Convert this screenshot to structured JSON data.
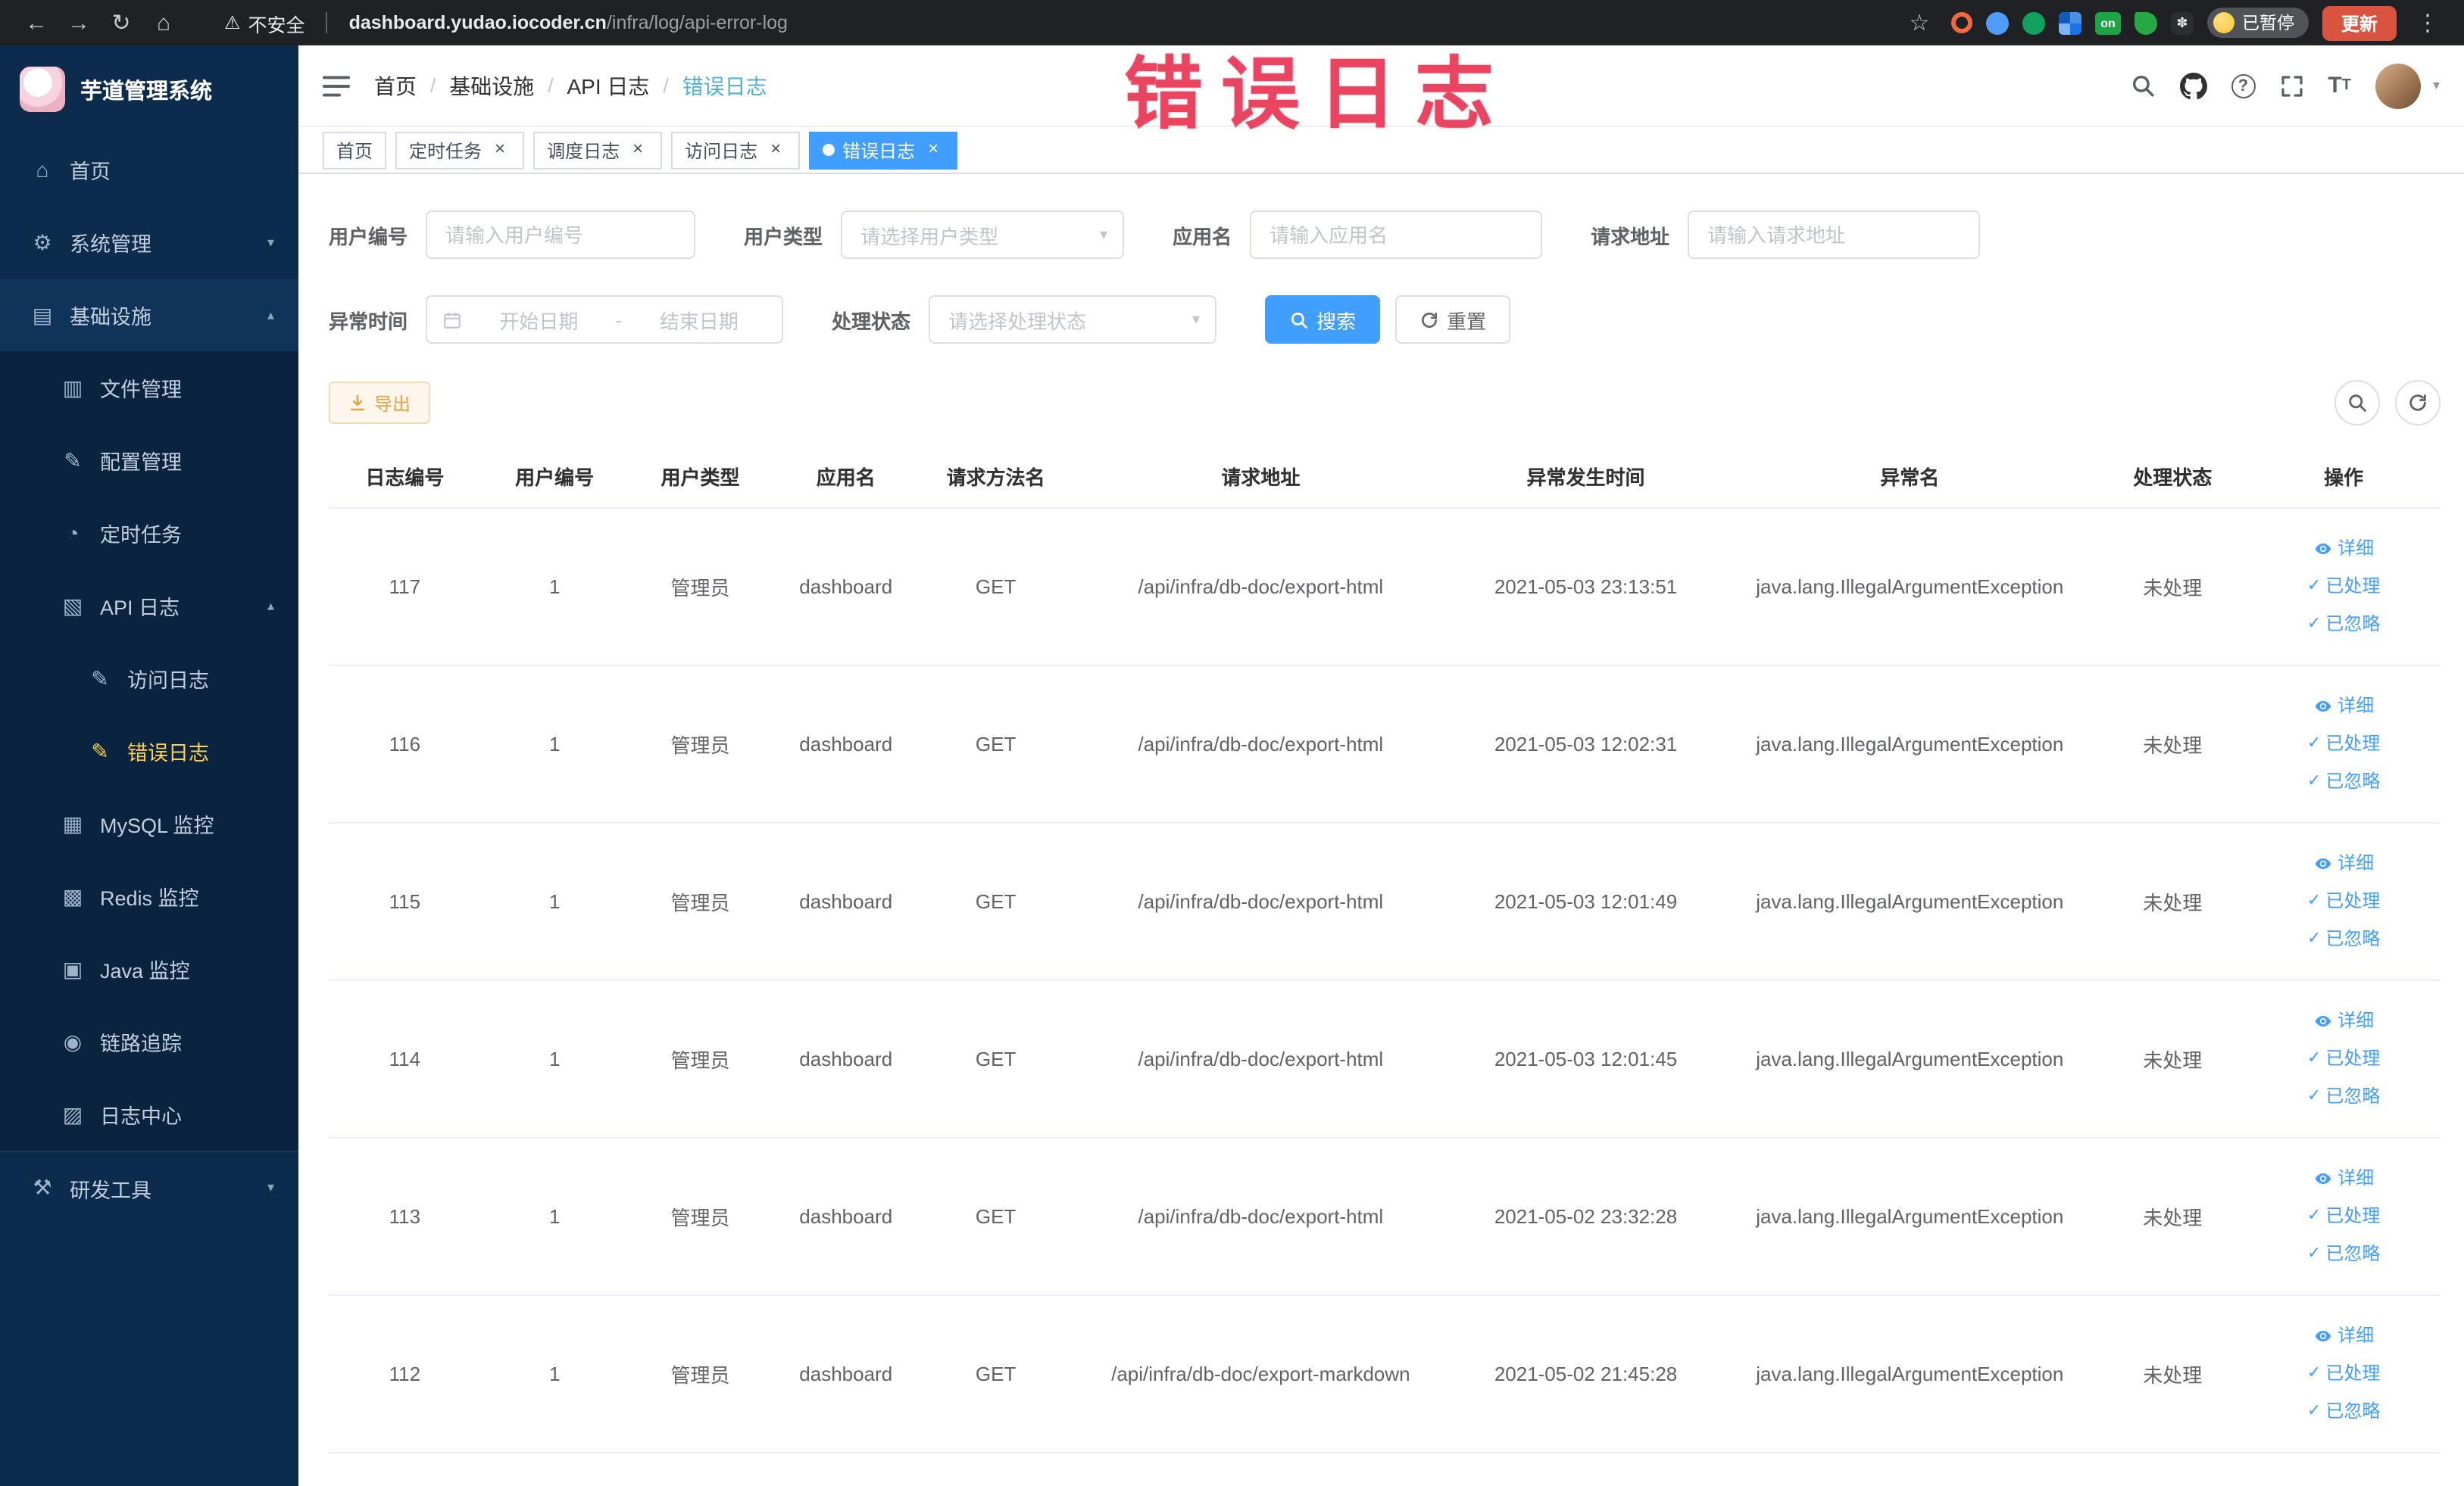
{
  "browser": {
    "warning_text": "不安全",
    "url_domain": "dashboard.yudao.iocoder.cn",
    "url_path": "/infra/log/api-error-log",
    "extension_on_label": "on",
    "paused_badge": "已暂停",
    "update_button": "更新"
  },
  "annotation": {
    "text": "错误日志"
  },
  "sidebar": {
    "logo_title": "芋道管理系统",
    "items": [
      {
        "key": "home",
        "label": "首页",
        "icon": "home-icon",
        "level": 1
      },
      {
        "key": "system-mgmt",
        "label": "系统管理",
        "icon": "gear-icon",
        "level": 1,
        "arrow": "down"
      },
      {
        "key": "infrastructure",
        "label": "基础设施",
        "icon": "infra-icon",
        "level": 1,
        "arrow": "up",
        "highlight": true
      },
      {
        "key": "file-mgmt",
        "label": "文件管理",
        "icon": "file-icon",
        "level": 2
      },
      {
        "key": "config-mgmt",
        "label": "配置管理",
        "icon": "config-icon",
        "level": 2
      },
      {
        "key": "cron-job",
        "label": "定时任务",
        "icon": "timer-icon",
        "level": 2
      },
      {
        "key": "api-log",
        "label": "API 日志",
        "icon": "api-log-icon",
        "level": 2,
        "arrow": "up"
      },
      {
        "key": "access-log",
        "label": "访问日志",
        "icon": "access-log-icon",
        "level": 3
      },
      {
        "key": "error-log",
        "label": "错误日志",
        "icon": "error-log-icon",
        "level": 3,
        "active": true
      },
      {
        "key": "mysql-monitor",
        "label": "MySQL 监控",
        "icon": "mysql-icon",
        "level": 2
      },
      {
        "key": "redis-monitor",
        "label": "Redis 监控",
        "icon": "redis-icon",
        "level": 2
      },
      {
        "key": "java-monitor",
        "label": "Java 监控",
        "icon": "java-icon",
        "level": 2
      },
      {
        "key": "tracing",
        "label": "链路追踪",
        "icon": "trace-icon",
        "level": 2
      },
      {
        "key": "log-center",
        "label": "日志中心",
        "icon": "log-center-icon",
        "level": 2
      },
      {
        "key": "dev-tools",
        "label": "研发工具",
        "icon": "tools-icon",
        "level": 1,
        "arrow": "down",
        "section": true
      }
    ]
  },
  "header": {
    "breadcrumbs": [
      {
        "key": "home",
        "label": "首页"
      },
      {
        "key": "infrastructure",
        "label": "基础设施"
      },
      {
        "key": "api-log",
        "label": "API 日志"
      },
      {
        "key": "error-log",
        "label": "错误日志",
        "current": true
      }
    ]
  },
  "tabs": [
    {
      "key": "home",
      "label": "首页",
      "closable": false,
      "active": false
    },
    {
      "key": "cron-job",
      "label": "定时任务",
      "closable": true,
      "active": false
    },
    {
      "key": "schedule-log",
      "label": "调度日志",
      "closable": true,
      "active": false
    },
    {
      "key": "access-log",
      "label": "访问日志",
      "closable": true,
      "active": false
    },
    {
      "key": "error-log",
      "label": "错误日志",
      "closable": true,
      "active": true
    }
  ],
  "filters": {
    "user_id": {
      "label": "用户编号",
      "placeholder": "请输入用户编号"
    },
    "user_type": {
      "label": "用户类型",
      "placeholder": "请选择用户类型"
    },
    "app_name": {
      "label": "应用名",
      "placeholder": "请输入应用名"
    },
    "request_url": {
      "label": "请求地址",
      "placeholder": "请输入请求地址"
    },
    "exception_time": {
      "label": "异常时间",
      "start_placeholder": "开始日期",
      "separator": "-",
      "end_placeholder": "结束日期"
    },
    "process_status": {
      "label": "处理状态",
      "placeholder": "请选择处理状态"
    },
    "search_button": "搜索",
    "reset_button": "重置"
  },
  "toolbar": {
    "export_button": "导出"
  },
  "table": {
    "columns": [
      "日志编号",
      "用户编号",
      "用户类型",
      "应用名",
      "请求方法名",
      "请求地址",
      "异常发生时间",
      "异常名",
      "处理状态",
      "操作"
    ],
    "actions": [
      "详细",
      "已处理",
      "已忽略"
    ],
    "rows": [
      {
        "id": "117",
        "user_id": "1",
        "user_type": "管理员",
        "app": "dashboard",
        "method": "GET",
        "url": "/api/infra/db-doc/export-html",
        "time": "2021-05-03 23:13:51",
        "exception": "java.lang.IllegalArgumentException",
        "status": "未处理"
      },
      {
        "id": "116",
        "user_id": "1",
        "user_type": "管理员",
        "app": "dashboard",
        "method": "GET",
        "url": "/api/infra/db-doc/export-html",
        "time": "2021-05-03 12:02:31",
        "exception": "java.lang.IllegalArgumentException",
        "status": "未处理"
      },
      {
        "id": "115",
        "user_id": "1",
        "user_type": "管理员",
        "app": "dashboard",
        "method": "GET",
        "url": "/api/infra/db-doc/export-html",
        "time": "2021-05-03 12:01:49",
        "exception": "java.lang.IllegalArgumentException",
        "status": "未处理"
      },
      {
        "id": "114",
        "user_id": "1",
        "user_type": "管理员",
        "app": "dashboard",
        "method": "GET",
        "url": "/api/infra/db-doc/export-html",
        "time": "2021-05-03 12:01:45",
        "exception": "java.lang.IllegalArgumentException",
        "status": "未处理"
      },
      {
        "id": "113",
        "user_id": "1",
        "user_type": "管理员",
        "app": "dashboard",
        "method": "GET",
        "url": "/api/infra/db-doc/export-html",
        "time": "2021-05-02 23:32:28",
        "exception": "java.lang.IllegalArgumentException",
        "status": "未处理"
      },
      {
        "id": "112",
        "user_id": "1",
        "user_type": "管理员",
        "app": "dashboard",
        "method": "GET",
        "url": "/api/infra/db-doc/export-markdown",
        "time": "2021-05-02 21:45:28",
        "exception": "java.lang.IllegalArgumentException",
        "status": "未处理"
      }
    ]
  }
}
